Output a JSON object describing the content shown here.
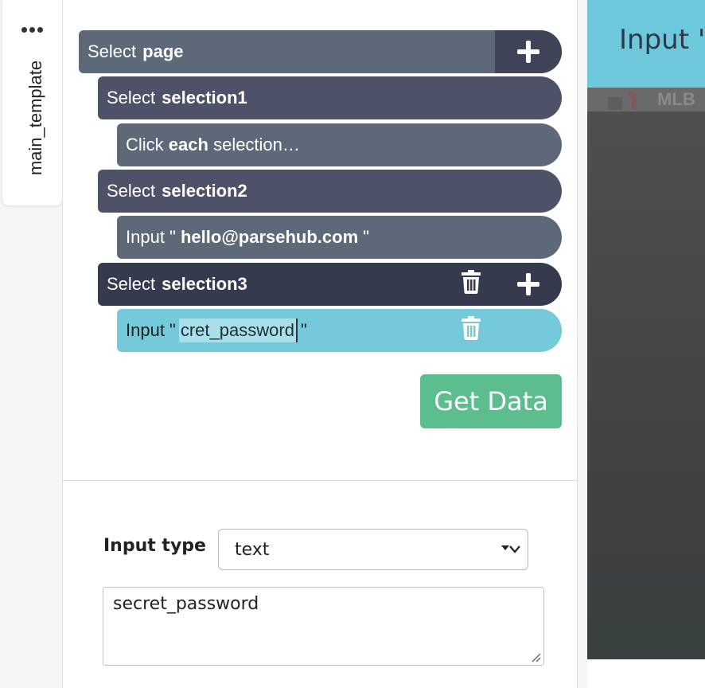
{
  "side_tab": {
    "label": "main_template"
  },
  "commands": {
    "page": {
      "verb": "Select",
      "target": "page"
    },
    "selection1": {
      "verb": "Select",
      "target": "selection1"
    },
    "click_each": {
      "verb": "Click",
      "strong": "each",
      "rest": "selection…"
    },
    "selection2": {
      "verb": "Select",
      "target": "selection2"
    },
    "input_email": {
      "prefix": "Input \"",
      "value": "hello@parsehub.com",
      "suffix": "\""
    },
    "selection3": {
      "verb": "Select",
      "target": "selection3"
    },
    "input_password": {
      "prefix": "Input \"",
      "value": "cret_password",
      "suffix": "\""
    }
  },
  "get_data_label": "Get Data",
  "input_type": {
    "label": "Input type",
    "selected": "text"
  },
  "value_field": {
    "value": "secret_password"
  },
  "viewport": {
    "header_text": "Input \"",
    "brand_text": "MLB"
  },
  "colors": {
    "accent_green": "#5cbd8d",
    "active_cyan": "#74c9da",
    "command_dark": "#4e5268"
  },
  "icons": [
    "more-dots-icon",
    "plus-icon",
    "trash-icon",
    "chevron-down-icon",
    "resize-grip-icon"
  ]
}
